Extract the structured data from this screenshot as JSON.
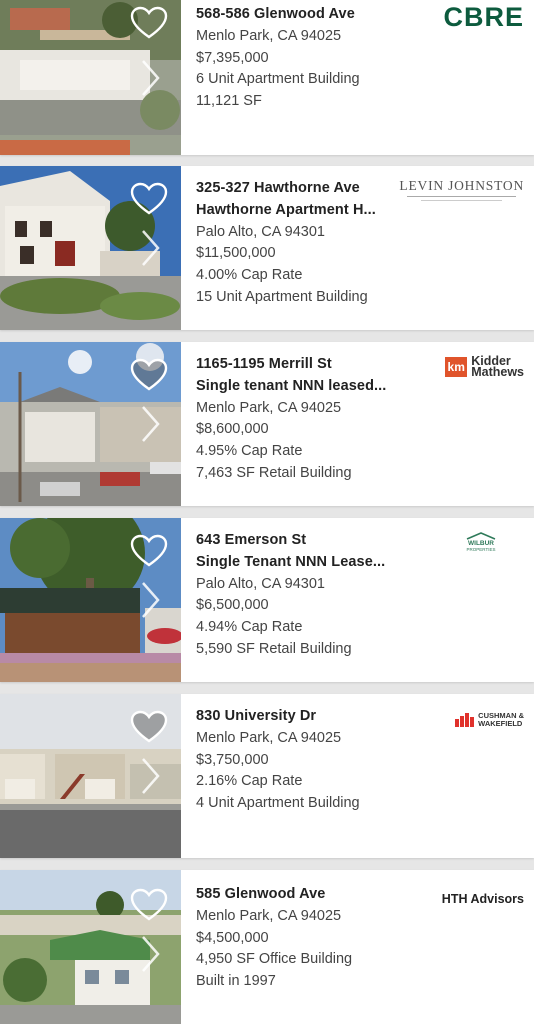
{
  "listings": [
    {
      "title_lines": [
        "568-586 Glenwood Ave"
      ],
      "details": [
        "Menlo Park, CA 94025",
        "$7,395,000",
        "6 Unit Apartment Building",
        "11,121 SF"
      ],
      "broker": {
        "name": "CBRE",
        "color": "#0d5b3e"
      },
      "favorite": false
    },
    {
      "title_lines": [
        "325-327 Hawthorne Ave",
        "Hawthorne Apartment H..."
      ],
      "details": [
        "Palo Alto, CA 94301",
        "$11,500,000",
        "4.00% Cap Rate",
        "15 Unit Apartment Building"
      ],
      "broker": {
        "name": "LEVIN JOHNSTON",
        "color": "#555555"
      },
      "favorite": false
    },
    {
      "title_lines": [
        "1165-1195 Merrill St",
        "Single tenant NNN leased..."
      ],
      "details": [
        "Menlo Park, CA 94025",
        "$8,600,000",
        "4.95% Cap Rate",
        "7,463 SF Retail Building"
      ],
      "broker": {
        "mark": "km",
        "name_lines": [
          "Kidder",
          "Mathews"
        ],
        "color": "#e0542b"
      },
      "favorite": true
    },
    {
      "title_lines": [
        "643 Emerson St",
        "Single Tenant NNN Lease..."
      ],
      "details": [
        "Palo Alto, CA 94301",
        "$6,500,000",
        "4.94% Cap Rate",
        "5,590 SF Retail Building"
      ],
      "broker": {
        "name_lines": [
          "WILBUR",
          "PROPERTIES"
        ],
        "color": "#2f7a5a"
      },
      "favorite": false
    },
    {
      "title_lines": [
        "830 University Dr"
      ],
      "details": [
        "Menlo Park, CA 94025",
        "$3,750,000",
        "2.16% Cap Rate",
        "4 Unit Apartment Building"
      ],
      "broker": {
        "name_lines": [
          "CUSHMAN &",
          "WAKEFIELD"
        ],
        "color": "#e0312b"
      },
      "favorite": true
    },
    {
      "title_lines": [
        "585 Glenwood Ave"
      ],
      "details": [
        "Menlo Park, CA 94025",
        "$4,500,000",
        "4,950 SF Office Building",
        "Built in 1997"
      ],
      "broker": {
        "name": "HTH Advisors",
        "color": "#222222"
      },
      "favorite": false
    }
  ]
}
